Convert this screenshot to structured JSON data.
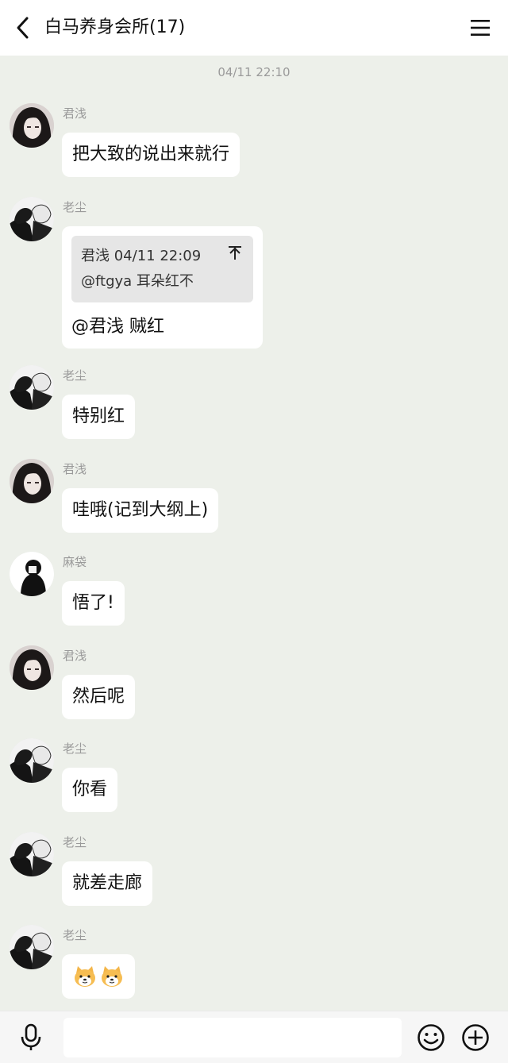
{
  "header": {
    "title": "白马养身会所(17)"
  },
  "timestamp": "04/11 22:10",
  "messages": [
    {
      "sender": "君浅",
      "text": "把大致的说出来就行"
    },
    {
      "sender": "老尘",
      "quote": {
        "meta": "君浅 04/11 22:09",
        "text": "@ftgya 耳朵红不"
      },
      "text": "@君浅 贼红"
    },
    {
      "sender": "老尘",
      "text": "特别红"
    },
    {
      "sender": "君浅",
      "text": "哇哦(记到大纲上)"
    },
    {
      "sender": "麻袋",
      "text": "悟了!"
    },
    {
      "sender": "君浅",
      "text": "然后呢"
    },
    {
      "sender": "老尘",
      "text": "你看"
    },
    {
      "sender": "老尘",
      "text": "就差走廊"
    },
    {
      "sender": "老尘",
      "emoji": [
        "dog-face-emoji",
        "dog-face-emoji"
      ]
    }
  ],
  "footer": {
    "input_value": "",
    "input_placeholder": ""
  }
}
